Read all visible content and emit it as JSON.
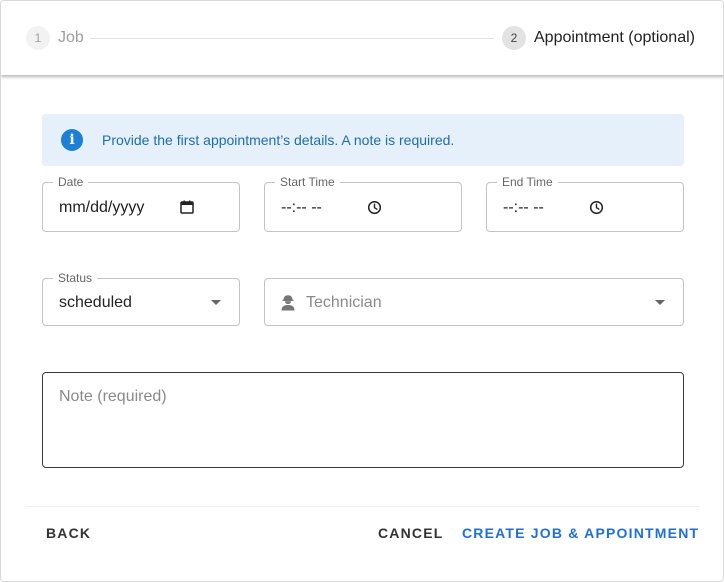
{
  "stepper": {
    "steps": [
      {
        "number": "1",
        "label": "Job"
      },
      {
        "number": "2",
        "label": "Appointment (optional)"
      }
    ]
  },
  "alert": {
    "icon": "info-icon",
    "text": "Provide the first appointment’s details. A note is required.",
    "color": "#1e7fd6"
  },
  "form": {
    "date": {
      "label": "Date",
      "value": "mm/dd/yyyy",
      "icon": "calendar-icon"
    },
    "start_time": {
      "label": "Start Time",
      "value": "--:-- --",
      "icon": "clock-icon"
    },
    "end_time": {
      "label": "End Time",
      "value": "--:-- --",
      "icon": "clock-icon"
    },
    "status": {
      "label": "Status",
      "value": "scheduled",
      "icon": "chevron-down-icon"
    },
    "technician": {
      "placeholder": "Technician",
      "icon": "worker-icon"
    },
    "note": {
      "placeholder": "Note (required)"
    }
  },
  "actions": {
    "back": "Back",
    "cancel": "Cancel",
    "create": "Create Job & Appointment",
    "primary_color": "#1f6fd6"
  }
}
